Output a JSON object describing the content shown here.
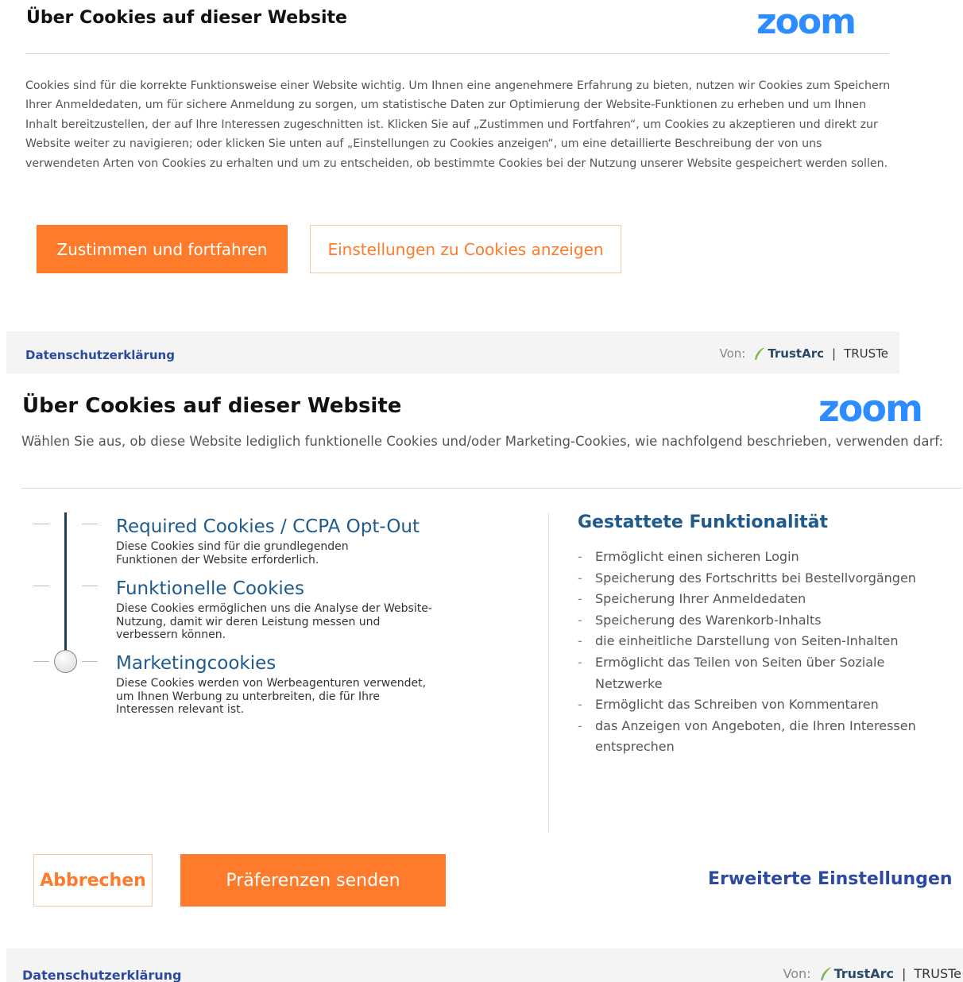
{
  "panel1": {
    "title": "Über Cookies auf dieser Website",
    "logo": "zoom",
    "body": "Cookies sind für die korrekte Funktionsweise einer Website wichtig. Um Ihnen eine angenehmere Erfahrung zu bieten, nutzen wir Cookies zum Speichern Ihrer Anmeldedaten, um für sichere Anmeldung zu sorgen, um statistische Daten zur Optimierung der Website-Funktionen zu erheben und um Ihnen Inhalt bereitzustellen, der auf Ihre Interessen zugeschnitten ist. Klicken Sie auf „Zustimmen und Fortfahren“, um Cookies zu akzeptieren und direkt zur Website weiter zu navigieren; oder klicken Sie unten auf „Einstellungen zu Cookies anzeigen“, um eine detaillierte Beschreibung der von uns verwendeten Arten von Cookies zu erhalten und um zu entscheiden, ob bestimmte Cookies bei der Nutzung unserer Website gespeichert werden sollen.",
    "accept_label": "Zustimmen und fortfahren",
    "settings_label": "Einstellungen zu Cookies anzeigen",
    "footer": {
      "privacy_label": "Datenschutzerklärung",
      "by_label": "Von:",
      "trustarc_label": "TrustArc",
      "separator": "|",
      "truste_label": "TRUSTe"
    }
  },
  "panel2": {
    "title": "Über Cookies auf dieser Website",
    "logo": "zoom",
    "subtitle": "Wählen Sie aus, ob diese Website lediglich funktionelle Cookies und/oder Marketing-Cookies, wie nachfolgend beschrieben, verwenden darf:",
    "slider_level": "Marketingcookies",
    "categories": [
      {
        "title": "Required Cookies / CCPA Opt-Out",
        "description": "Diese Cookies sind für die grundlegenden Funktionen der Website erforderlich."
      },
      {
        "title": "Funktionelle Cookies",
        "description": "Diese Cookies ermöglichen uns die Analyse der Website-Nutzung, damit wir deren Leistung messen und verbessern können."
      },
      {
        "title": "Marketingcookies",
        "description": "Diese Cookies werden von Werbeagenturen verwendet, um Ihnen Werbung zu unterbreiten, die für Ihre Interessen relevant ist."
      }
    ],
    "allowed_title": "Gestattete Funktionalität",
    "allowed_items": [
      "Ermöglicht einen sicheren Login",
      "Speicherung des Fortschritts bei Bestellvorgängen",
      "Speicherung Ihrer Anmeldedaten",
      "Speicherung des Warenkorb-Inhalts",
      "die einheitliche Darstellung von Seiten-Inhalten",
      "Ermöglicht das Teilen von Seiten über Soziale Netzwerke",
      "Ermöglicht das Schreiben von Kommentaren",
      "das Anzeigen von Angeboten, die Ihren Interessen entsprechen"
    ],
    "cancel_label": "Abbrechen",
    "send_label": "Präferenzen senden",
    "advanced_label": "Erweiterte Einstellungen",
    "footer": {
      "privacy_label": "Datenschutzerklärung",
      "by_label": "Von:",
      "trustarc_label": "TrustArc",
      "separator": "|",
      "truste_label": "TRUSTe"
    }
  },
  "colors": {
    "accent": "#fd7b2a",
    "link": "#2b4aa0",
    "heading_blue": "#1f5a8c",
    "logo_blue": "#2d8cff"
  },
  "icons": [
    "trustarc-leaf-icon",
    "slider-knob"
  ]
}
